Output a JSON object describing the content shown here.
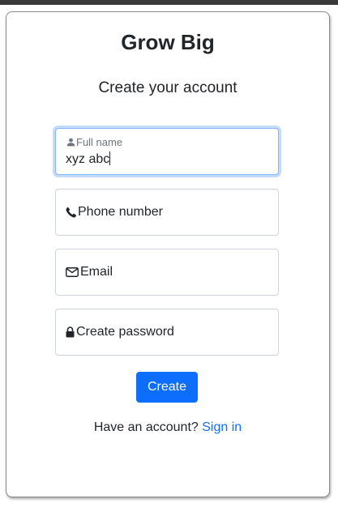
{
  "brand": "Grow Big",
  "subtitle": "Create your account",
  "form": {
    "full_name": {
      "label": "Full name",
      "value": "xyz abc",
      "icon": "person-icon"
    },
    "phone": {
      "placeholder": "Phone number",
      "icon": "phone-icon"
    },
    "email": {
      "placeholder": "Email",
      "icon": "envelope-icon"
    },
    "password": {
      "placeholder": "Create password",
      "icon": "lock-icon"
    },
    "submit_label": "Create"
  },
  "footer": {
    "prompt": "Have an account?",
    "link": "Sign in"
  },
  "colors": {
    "primary": "#0d6efd",
    "focus_border": "#86b7fe",
    "border": "#ced4da"
  }
}
